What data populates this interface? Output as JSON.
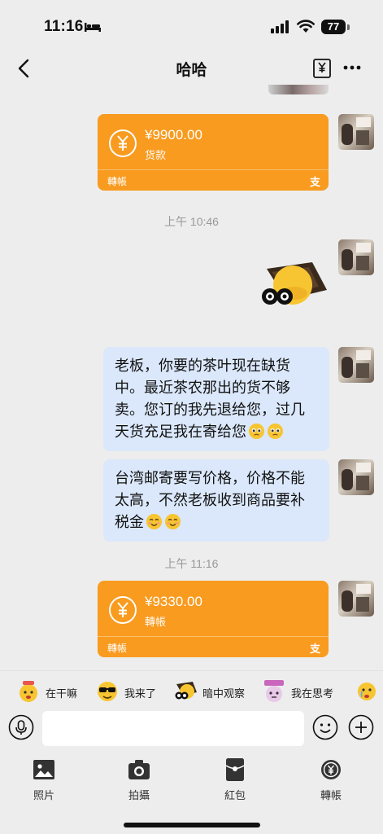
{
  "status_bar": {
    "time": "11:16",
    "battery": "77"
  },
  "header": {
    "title": "哈哈"
  },
  "messages": {
    "transfer1": {
      "amount": "¥9900.00",
      "note": "货款",
      "footer": "轉帳",
      "logo": "支"
    },
    "timestamp1": "上午 10:46",
    "sticker": "binoculars-sticker",
    "text1_lines": [
      "老板，你要的茶叶现在缺货",
      "中。最近茶农那出的货不够",
      "卖。您订的我先退给您，过几",
      "天货充足我在寄给您"
    ],
    "text2_lines": [
      "台湾邮寄要写价格，价格不能",
      "太高，不然老板收到商品要补",
      "税金"
    ],
    "timestamp2": "上午 11:16",
    "transfer2": {
      "amount": "¥9330.00",
      "note": "轉帳",
      "footer": "轉帳",
      "logo": "支"
    }
  },
  "quick_stickers": [
    {
      "label": "在干嘛",
      "icon": "what-are-you-doing-sticker-icon"
    },
    {
      "label": "我来了",
      "icon": "sunglasses-sticker-icon"
    },
    {
      "label": "暗中观察",
      "icon": "binoculars-sticker-icon"
    },
    {
      "label": "我在思考",
      "icon": "thinking-sticker-icon"
    }
  ],
  "input": {
    "placeholder": ""
  },
  "tools": [
    {
      "label": "照片",
      "icon": "photo-icon"
    },
    {
      "label": "拍攝",
      "icon": "camera-icon"
    },
    {
      "label": "紅包",
      "icon": "red-packet-icon"
    },
    {
      "label": "轉帳",
      "icon": "transfer-icon"
    }
  ],
  "colors": {
    "background": "#ededed",
    "transfer": "#f89b1f",
    "bubble": "#dbe8fb"
  }
}
